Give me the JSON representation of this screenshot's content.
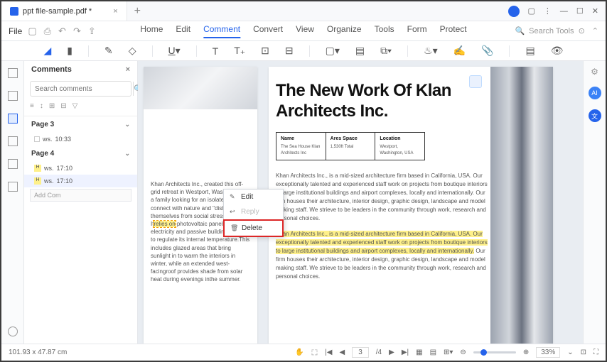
{
  "titlebar": {
    "filename": "ppt file-sample.pdf *"
  },
  "menu": {
    "file": "File",
    "tabs": [
      "Home",
      "Edit",
      "Comment",
      "Convert",
      "View",
      "Organize",
      "Tools",
      "Form",
      "Protect"
    ],
    "active_tab": "Comment",
    "search_placeholder": "Search Tools"
  },
  "comments_panel": {
    "title": "Comments",
    "search_placeholder": "Search comments",
    "pages": [
      {
        "label": "Page 3",
        "items": [
          {
            "user": "ws.",
            "time": "10:33"
          }
        ]
      },
      {
        "label": "Page 4",
        "items": [
          {
            "user": "ws.",
            "time": "17:10"
          },
          {
            "user": "ws.",
            "time": "17:10"
          }
        ]
      }
    ],
    "add_placeholder": "Add Com"
  },
  "context_menu": {
    "edit": "Edit",
    "reply": "Reply",
    "delete": "Delete"
  },
  "doc": {
    "page1_text": "Khan Architects Inc., created this off-grid retreat in Westport, Washington for a family looking for an isolated place to connect with nature and \"distance themselves from social stresses\".",
    "page1_highlight": "relies on",
    "page1_text2_a": "It",
    "page1_text2_b": " photovoltaic panels for electricity and passive building designs to regulate its internal temperature.This includes glazed areas that bring sunlight in to warm the interiors in winter, while an extended west-facingroof provides shade from solar heat during evenings inthe summer.",
    "page2_title": "The New Work Of Klan Architects Inc.",
    "table": {
      "h1": "Name",
      "v1a": "The Sea House Klan",
      "v1b": "Architects Inc",
      "h2": "Ares Space",
      "v2": "1,530ft Total",
      "h3": "Location",
      "v3a": "Westport,",
      "v3b": "Washington, USA"
    },
    "para1": "Khan Architects Inc., is a mid-sized architecture firm based in California, USA. Our exceptionally talented and experienced staff work on projects from boutique interiors to large institutional buildings and airport complexes, locally and internationally. Our firm houses their architecture, interior design, graphic design, landscape and model making staff. We strieve to be leaders in the community through work, research and personal choices.",
    "para2_hl": "Khan Architects Inc., is a mid-sized architecture firm based in California, USA. Our exceptionally talented and experienced staff work on projects from boutique interiors to large institutional buildings and airport complexes, locally and internationally.",
    "para2_rest": " Our firm houses their architecture, interior design, graphic design, landscape and model making staff. We strieve to be leaders in the community through work, research and personal choices."
  },
  "statusbar": {
    "dims": "101.93 x 47.87 cm",
    "page_current": "3",
    "page_total": "/4",
    "zoom": "33%"
  }
}
